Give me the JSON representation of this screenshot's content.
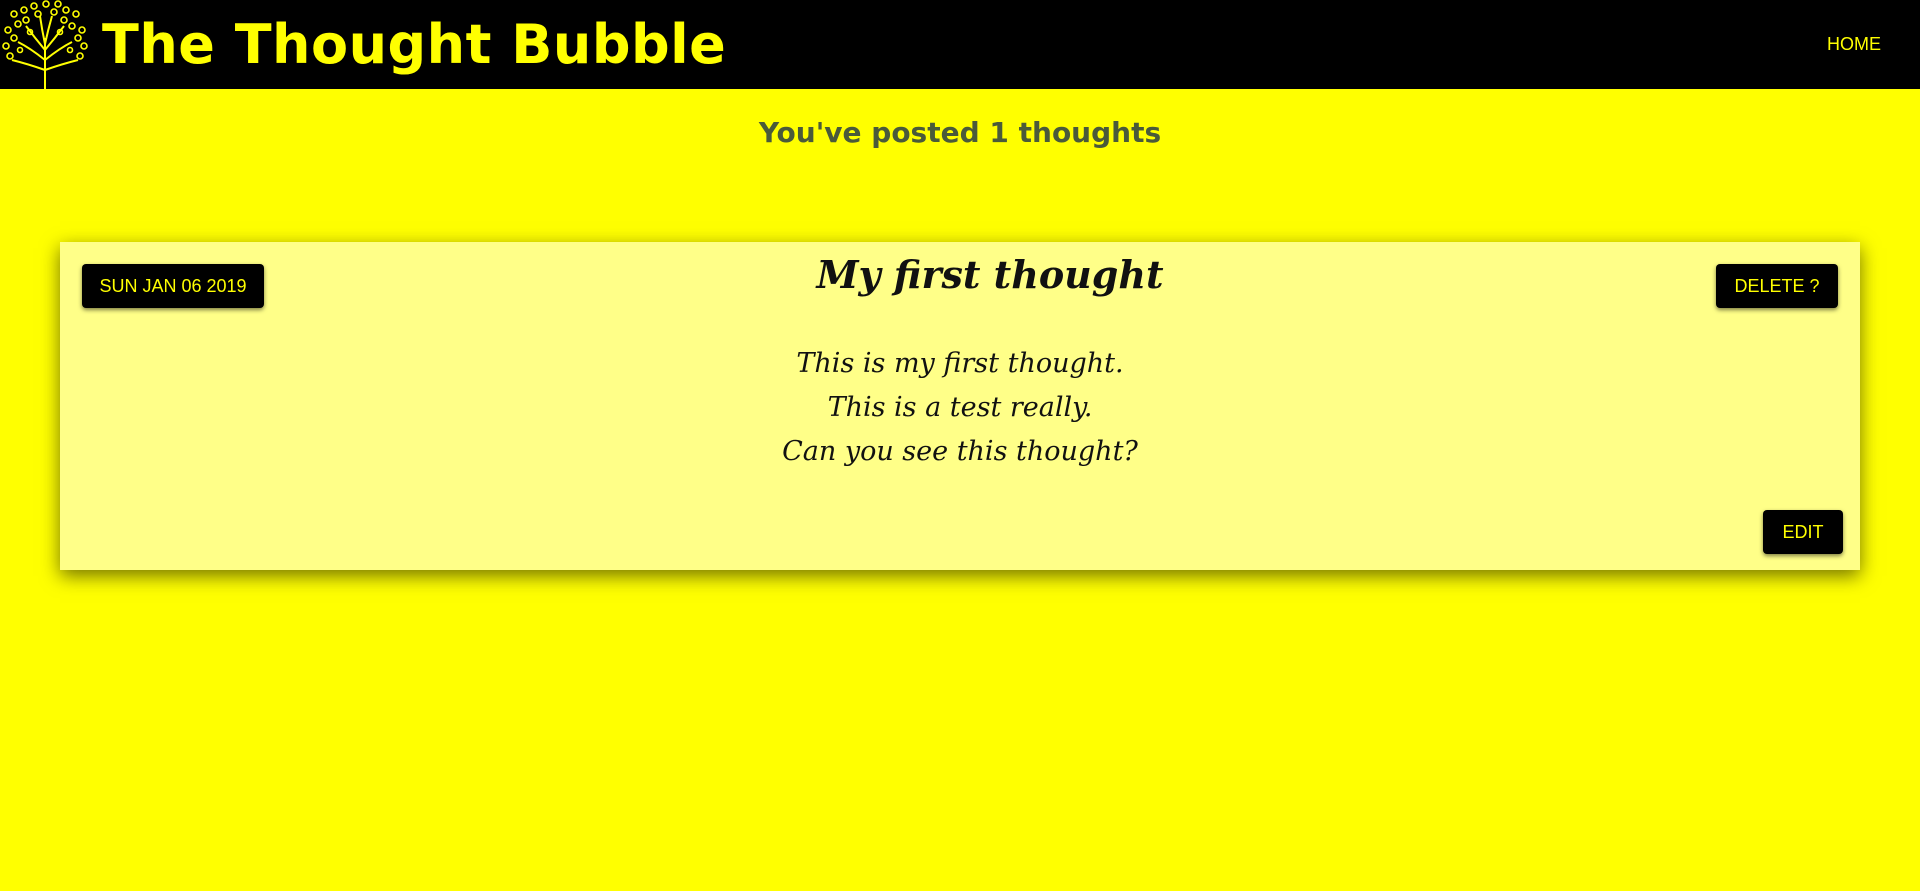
{
  "header": {
    "title": "The Thought Bubble",
    "nav_home": "HOME",
    "logo_icon": "tree-icon"
  },
  "summary": {
    "text": "You've posted 1 thoughts"
  },
  "thought": {
    "date": "SUN JAN 06 2019",
    "title": "My first thought",
    "lines": [
      "This is my first thought.",
      "This is a test really.",
      "Can you see this thought?"
    ],
    "delete_label": "DELETE ?",
    "edit_label": "EDIT"
  },
  "colors": {
    "background": "#ffff00",
    "header_bg": "#000000",
    "accent": "#ffff00",
    "card_bg": "#ffff88",
    "summary_text": "#4a5a3a"
  }
}
